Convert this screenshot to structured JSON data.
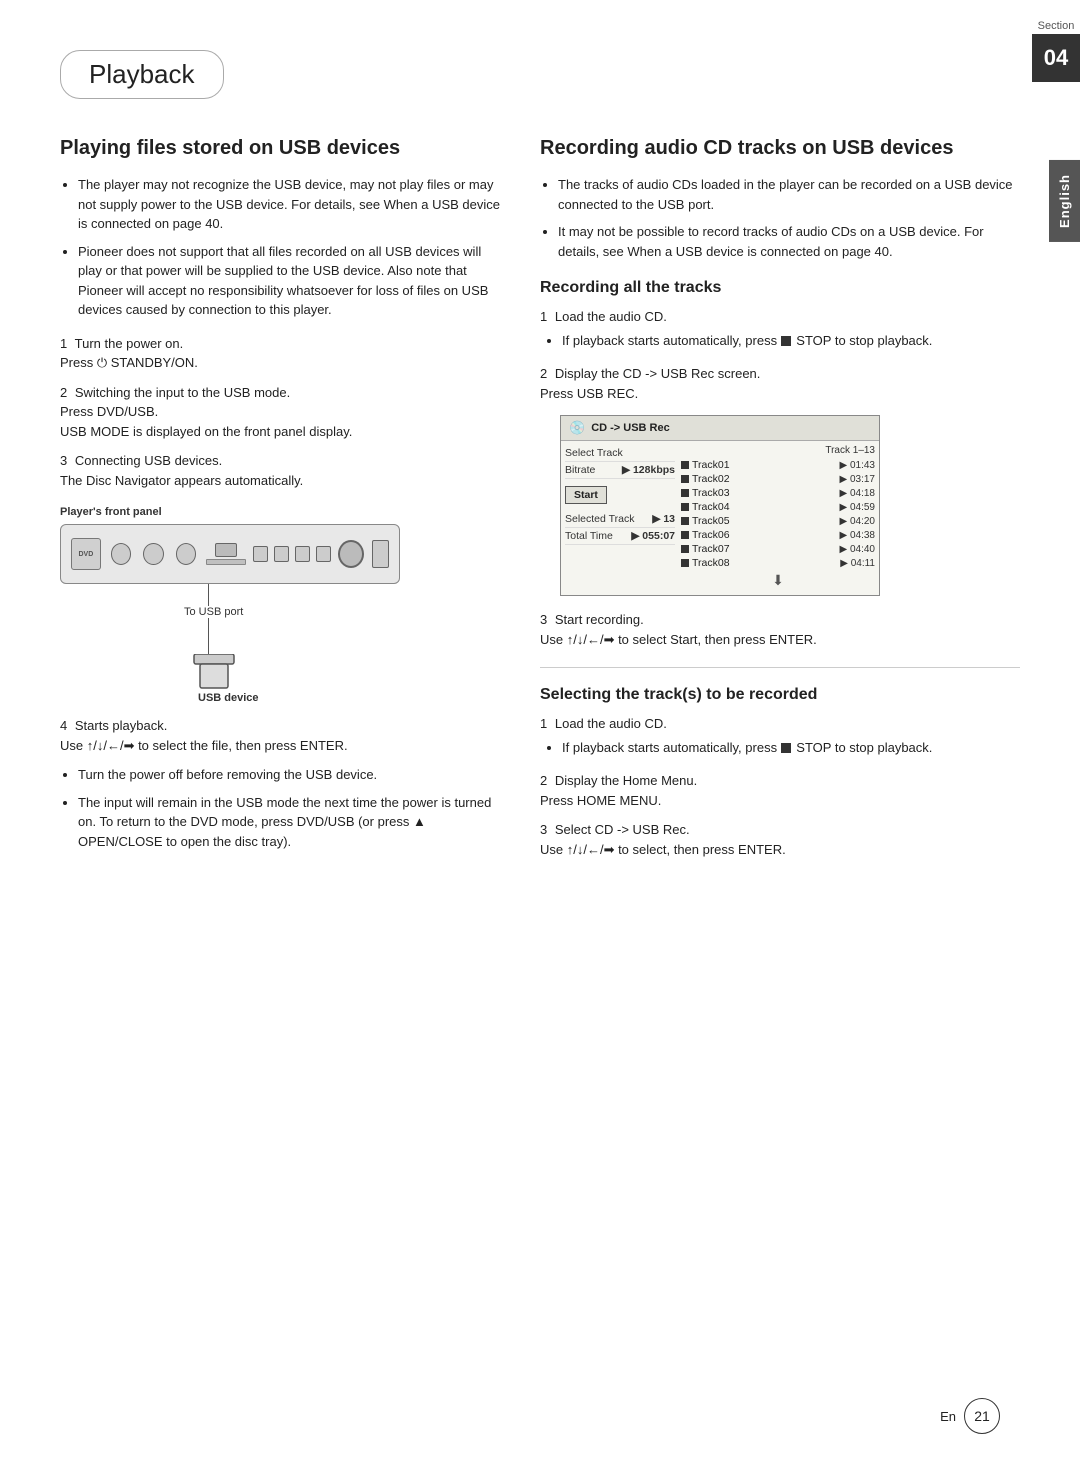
{
  "section": {
    "label": "Section",
    "number": "04"
  },
  "language_tab": "English",
  "header": {
    "title": "Playback"
  },
  "left_col": {
    "heading": "Playing files stored on USB devices",
    "bullets": [
      "The player may not recognize the USB device, may not play files or may not supply power to the USB device. For details, see When a USB device is connected on page 40.",
      "Pioneer does not support that all files recorded on all USB devices will play or that power will be supplied to the USB device. Also note that Pioneer will accept no responsibility whatsoever for loss of files on USB devices caused by connection to this player."
    ],
    "step1": {
      "num": "1",
      "text": "Turn the power on.",
      "sub": "Press ⏻ STANDBY/ON."
    },
    "step2": {
      "num": "2",
      "text": "Switching the input to the USB mode.",
      "sub": "Press DVD/USB.",
      "note": "USB MODE is displayed on the front panel display."
    },
    "step3": {
      "num": "3",
      "text": "Connecting USB devices.",
      "sub": "The Disc Navigator appears automatically."
    },
    "player_label": "Player's front panel",
    "usb_port_label": "To USB port",
    "usb_device_label": "USB device",
    "step4": {
      "num": "4",
      "text": "Starts playback.",
      "sub": "Use ↑/↓/←/➡ to select the file, then press ENTER."
    },
    "bullets2": [
      "Turn the power off before removing the USB device.",
      "The input will remain in the USB mode the next time the power is turned on. To return to the DVD mode, press DVD/USB (or press ▲ OPEN/CLOSE to open the disc tray)."
    ]
  },
  "right_col": {
    "heading": "Recording audio CD tracks on USB devices",
    "bullets": [
      "The tracks of audio CDs loaded in the player can be recorded on a USB device connected to the USB port.",
      "It may not be possible to record tracks of audio CDs on a USB device. For details, see When a USB device is connected on page 40."
    ],
    "recording_all": {
      "heading": "Recording all the tracks",
      "step1": {
        "num": "1",
        "text": "Load the audio CD.",
        "sub_bullet": "If playback starts automatically, press ■ STOP to stop playback."
      },
      "step2": {
        "num": "2",
        "text": "Display the CD -> USB Rec screen.",
        "sub": "Press USB REC."
      },
      "cd_screen": {
        "title": "CD -> USB Rec",
        "track_range": "Track 1–13",
        "rows_left": [
          {
            "label": "Select Track",
            "value": ""
          },
          {
            "label": "Bitrate",
            "value": "▶ 128kbps"
          },
          {
            "label": "",
            "value": ""
          },
          {
            "label": "Start",
            "value": ""
          },
          {
            "label": "Selected Track",
            "value": "▶ 13"
          },
          {
            "label": "Total Time",
            "value": "▶ 055:07"
          }
        ],
        "tracks": [
          {
            "name": "Track01",
            "time": "▶ 01:43"
          },
          {
            "name": "Track02",
            "time": "▶ 03:17"
          },
          {
            "name": "Track03",
            "time": "▶ 04:18"
          },
          {
            "name": "Track04",
            "time": "▶ 04:59"
          },
          {
            "name": "Track05",
            "time": "▶ 04:20"
          },
          {
            "name": "Track06",
            "time": "▶ 04:38"
          },
          {
            "name": "Track07",
            "time": "▶ 04:40"
          },
          {
            "name": "Track08",
            "time": "▶ 04:11"
          }
        ]
      },
      "step3": {
        "num": "3",
        "text": "Start recording.",
        "sub": "Use ↑/↓/←/➡ to select Start, then press ENTER."
      }
    },
    "selecting_tracks": {
      "heading": "Selecting the track(s) to be recorded",
      "step1": {
        "num": "1",
        "text": "Load the audio CD.",
        "sub_bullet": "If playback starts automatically, press ■ STOP to stop playback."
      },
      "step2": {
        "num": "2",
        "text": "Display the Home Menu.",
        "sub": "Press HOME MENU."
      },
      "step3": {
        "num": "3",
        "text": "Select CD -> USB Rec.",
        "sub": "Use ↑/↓/←/➡ to select, then press ENTER."
      }
    }
  },
  "footer": {
    "en_label": "En",
    "page_num": "21"
  }
}
